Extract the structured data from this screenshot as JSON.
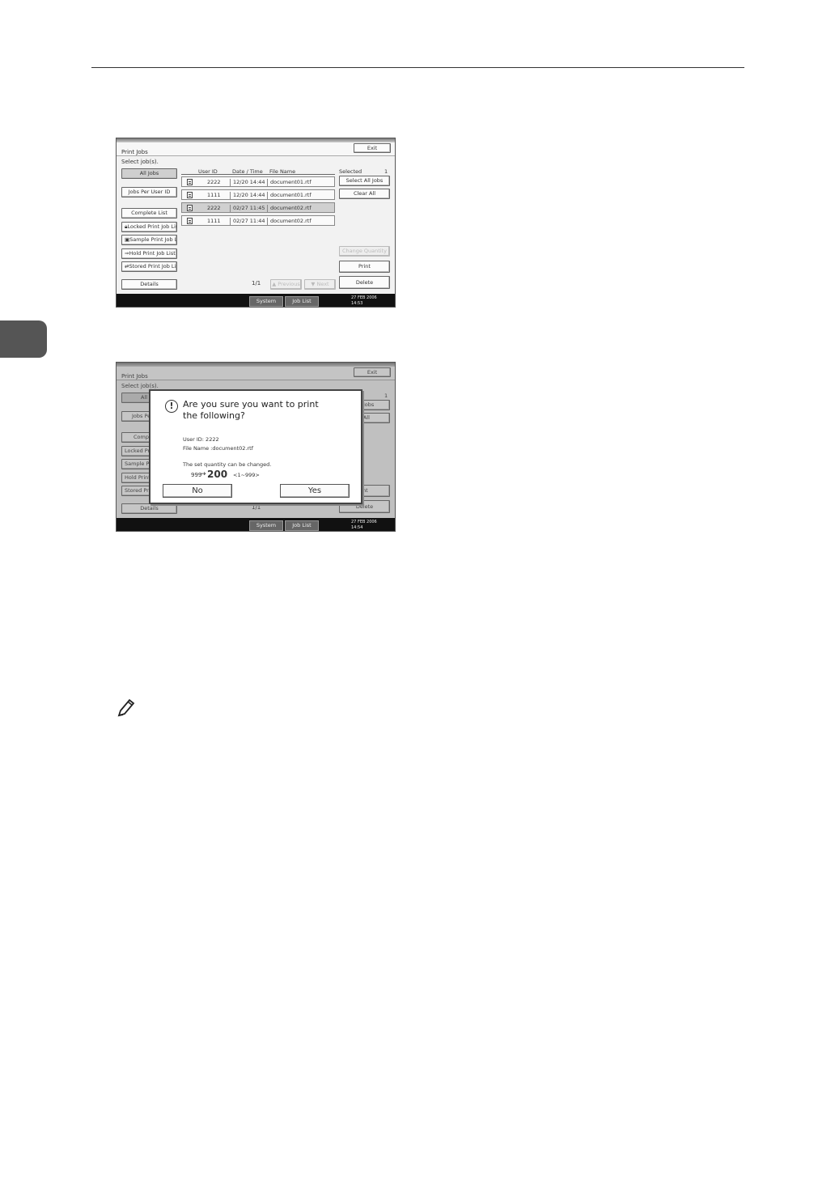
{
  "screen": {
    "title": "Print Jobs",
    "exit_label": "Exit",
    "select_label": "Select job(s).",
    "left_buttons": {
      "all_jobs": "All Jobs",
      "jobs_per_user": "Jobs Per User ID",
      "complete_list": "Complete List",
      "locked": "Locked Print Job List",
      "sample": "Sample Print Job List",
      "hold": "Hold Print Job List",
      "stored": "Stored Print Job List",
      "details": "Details"
    },
    "columns": {
      "user_id": "User ID",
      "datetime": "Date / Time",
      "file_name": "File Name"
    },
    "jobs": [
      {
        "user": "2222",
        "datetime": "12/20 14:44",
        "file": "document01.rtf",
        "selected": false
      },
      {
        "user": "1111",
        "datetime": "12/20 14:44",
        "file": "document01.rtf",
        "selected": false
      },
      {
        "user": "2222",
        "datetime": "02/27 11:45",
        "file": "document02.rtf",
        "selected": true
      },
      {
        "user": "1111",
        "datetime": "02/27 11:44",
        "file": "document02.rtf",
        "selected": false
      }
    ],
    "selected_label": "Selected",
    "selected_count": "1",
    "select_all": "Select All Jobs",
    "clear_all": "Clear All",
    "change_disabled": "Change Quantity",
    "print": "Print",
    "delete": "Delete",
    "page": "1/1",
    "prev": "▲ Previous",
    "next": "▼ Next",
    "bar": {
      "system_status": "System Status",
      "job_list": "Job List",
      "date_1": "27 FEB   2006",
      "time_1": "14:53",
      "date_2": "27 FEB   2006",
      "time_2": "14:54"
    }
  },
  "dialog": {
    "question_line1": "Are you sure you want to print",
    "question_line2": "the following?",
    "user_line": "User ID: 2222",
    "file_line": "File Name :document02.rtf",
    "quantity_note": "The set quantity can be changed.",
    "old_quantity": "999",
    "arrow": "→",
    "new_quantity": "200",
    "range": "<1~999>",
    "no": "No",
    "yes": "Yes"
  },
  "background_fragments": {
    "all": "All",
    "jobs_pe": "Jobs Pe",
    "compl": "Compl",
    "locked_pr": "Locked Pri",
    "sample_pr": "Sample Pr",
    "hold_prin": "Hold Print",
    "stored_pr": "Stored Pri",
    "all_jobs": "All Jobs",
    "r_all": "r All",
    "int": "int",
    "select_trunc": "Select job(s)."
  }
}
